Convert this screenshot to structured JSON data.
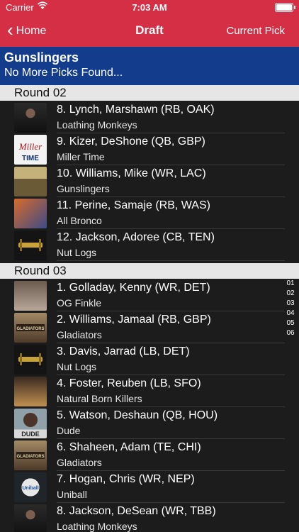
{
  "status": {
    "carrier": "Carrier",
    "time": "7:03 AM"
  },
  "nav": {
    "back": "Home",
    "title": "Draft",
    "right": "Current Pick"
  },
  "team": {
    "name": "Gunslingers",
    "message": "No More Picks Found..."
  },
  "rounds": [
    {
      "label": "Round 02",
      "picks": [
        {
          "player": "8. Lynch, Marshawn (RB, OAK)",
          "team": "Loathing Monkeys",
          "thumb": "lynch"
        },
        {
          "player": "9. Kizer, DeShone (QB, GBP)",
          "team": "Miller Time",
          "thumb": "miller"
        },
        {
          "player": "10. Williams, Mike (WR, LAC)",
          "team": "Gunslingers",
          "thumb": "gunslingers"
        },
        {
          "player": "11. Perine, Samaje (RB, WAS)",
          "team": "All Bronco",
          "thumb": "bronco"
        },
        {
          "player": "12. Jackson, Adoree (CB, TEN)",
          "team": "Nut Logs",
          "thumb": "nutlogs"
        }
      ]
    },
    {
      "label": "Round 03",
      "picks": [
        {
          "player": "1. Golladay, Kenny (WR, DET)",
          "team": "OG Finkle",
          "thumb": "ogfinkle"
        },
        {
          "player": "2. Williams, Jamaal (RB, GBP)",
          "team": "Gladiators",
          "thumb": "gladiators"
        },
        {
          "player": "3. Davis, Jarrad (LB, DET)",
          "team": "Nut Logs",
          "thumb": "nutlogs"
        },
        {
          "player": "4. Foster, Reuben (LB, SFO)",
          "team": "Natural Born Killers",
          "thumb": "nbk"
        },
        {
          "player": "5. Watson, Deshaun (QB, HOU)",
          "team": "Dude",
          "thumb": "dude"
        },
        {
          "player": "6. Shaheen, Adam (TE, CHI)",
          "team": "Gladiators",
          "thumb": "gladiators"
        },
        {
          "player": "7. Hogan, Chris (WR, NEP)",
          "team": "Uniball",
          "thumb": "uniball"
        },
        {
          "player": "8. Jackson, DeSean (WR, TBB)",
          "team": "Loathing Monkeys",
          "thumb": "lynch"
        }
      ]
    }
  ],
  "index": [
    "01",
    "02",
    "03",
    "04",
    "05",
    "06"
  ],
  "logo_text": {
    "miller_time": "Miller TIME",
    "gladiators": "GLADIATORS",
    "dude": "DUDE",
    "uniball": "Uniball"
  },
  "colors": {
    "nav": "#d42f45",
    "team_header": "#133d8c",
    "background": "#1c1c1c",
    "round_header": "#e6e6e6"
  }
}
